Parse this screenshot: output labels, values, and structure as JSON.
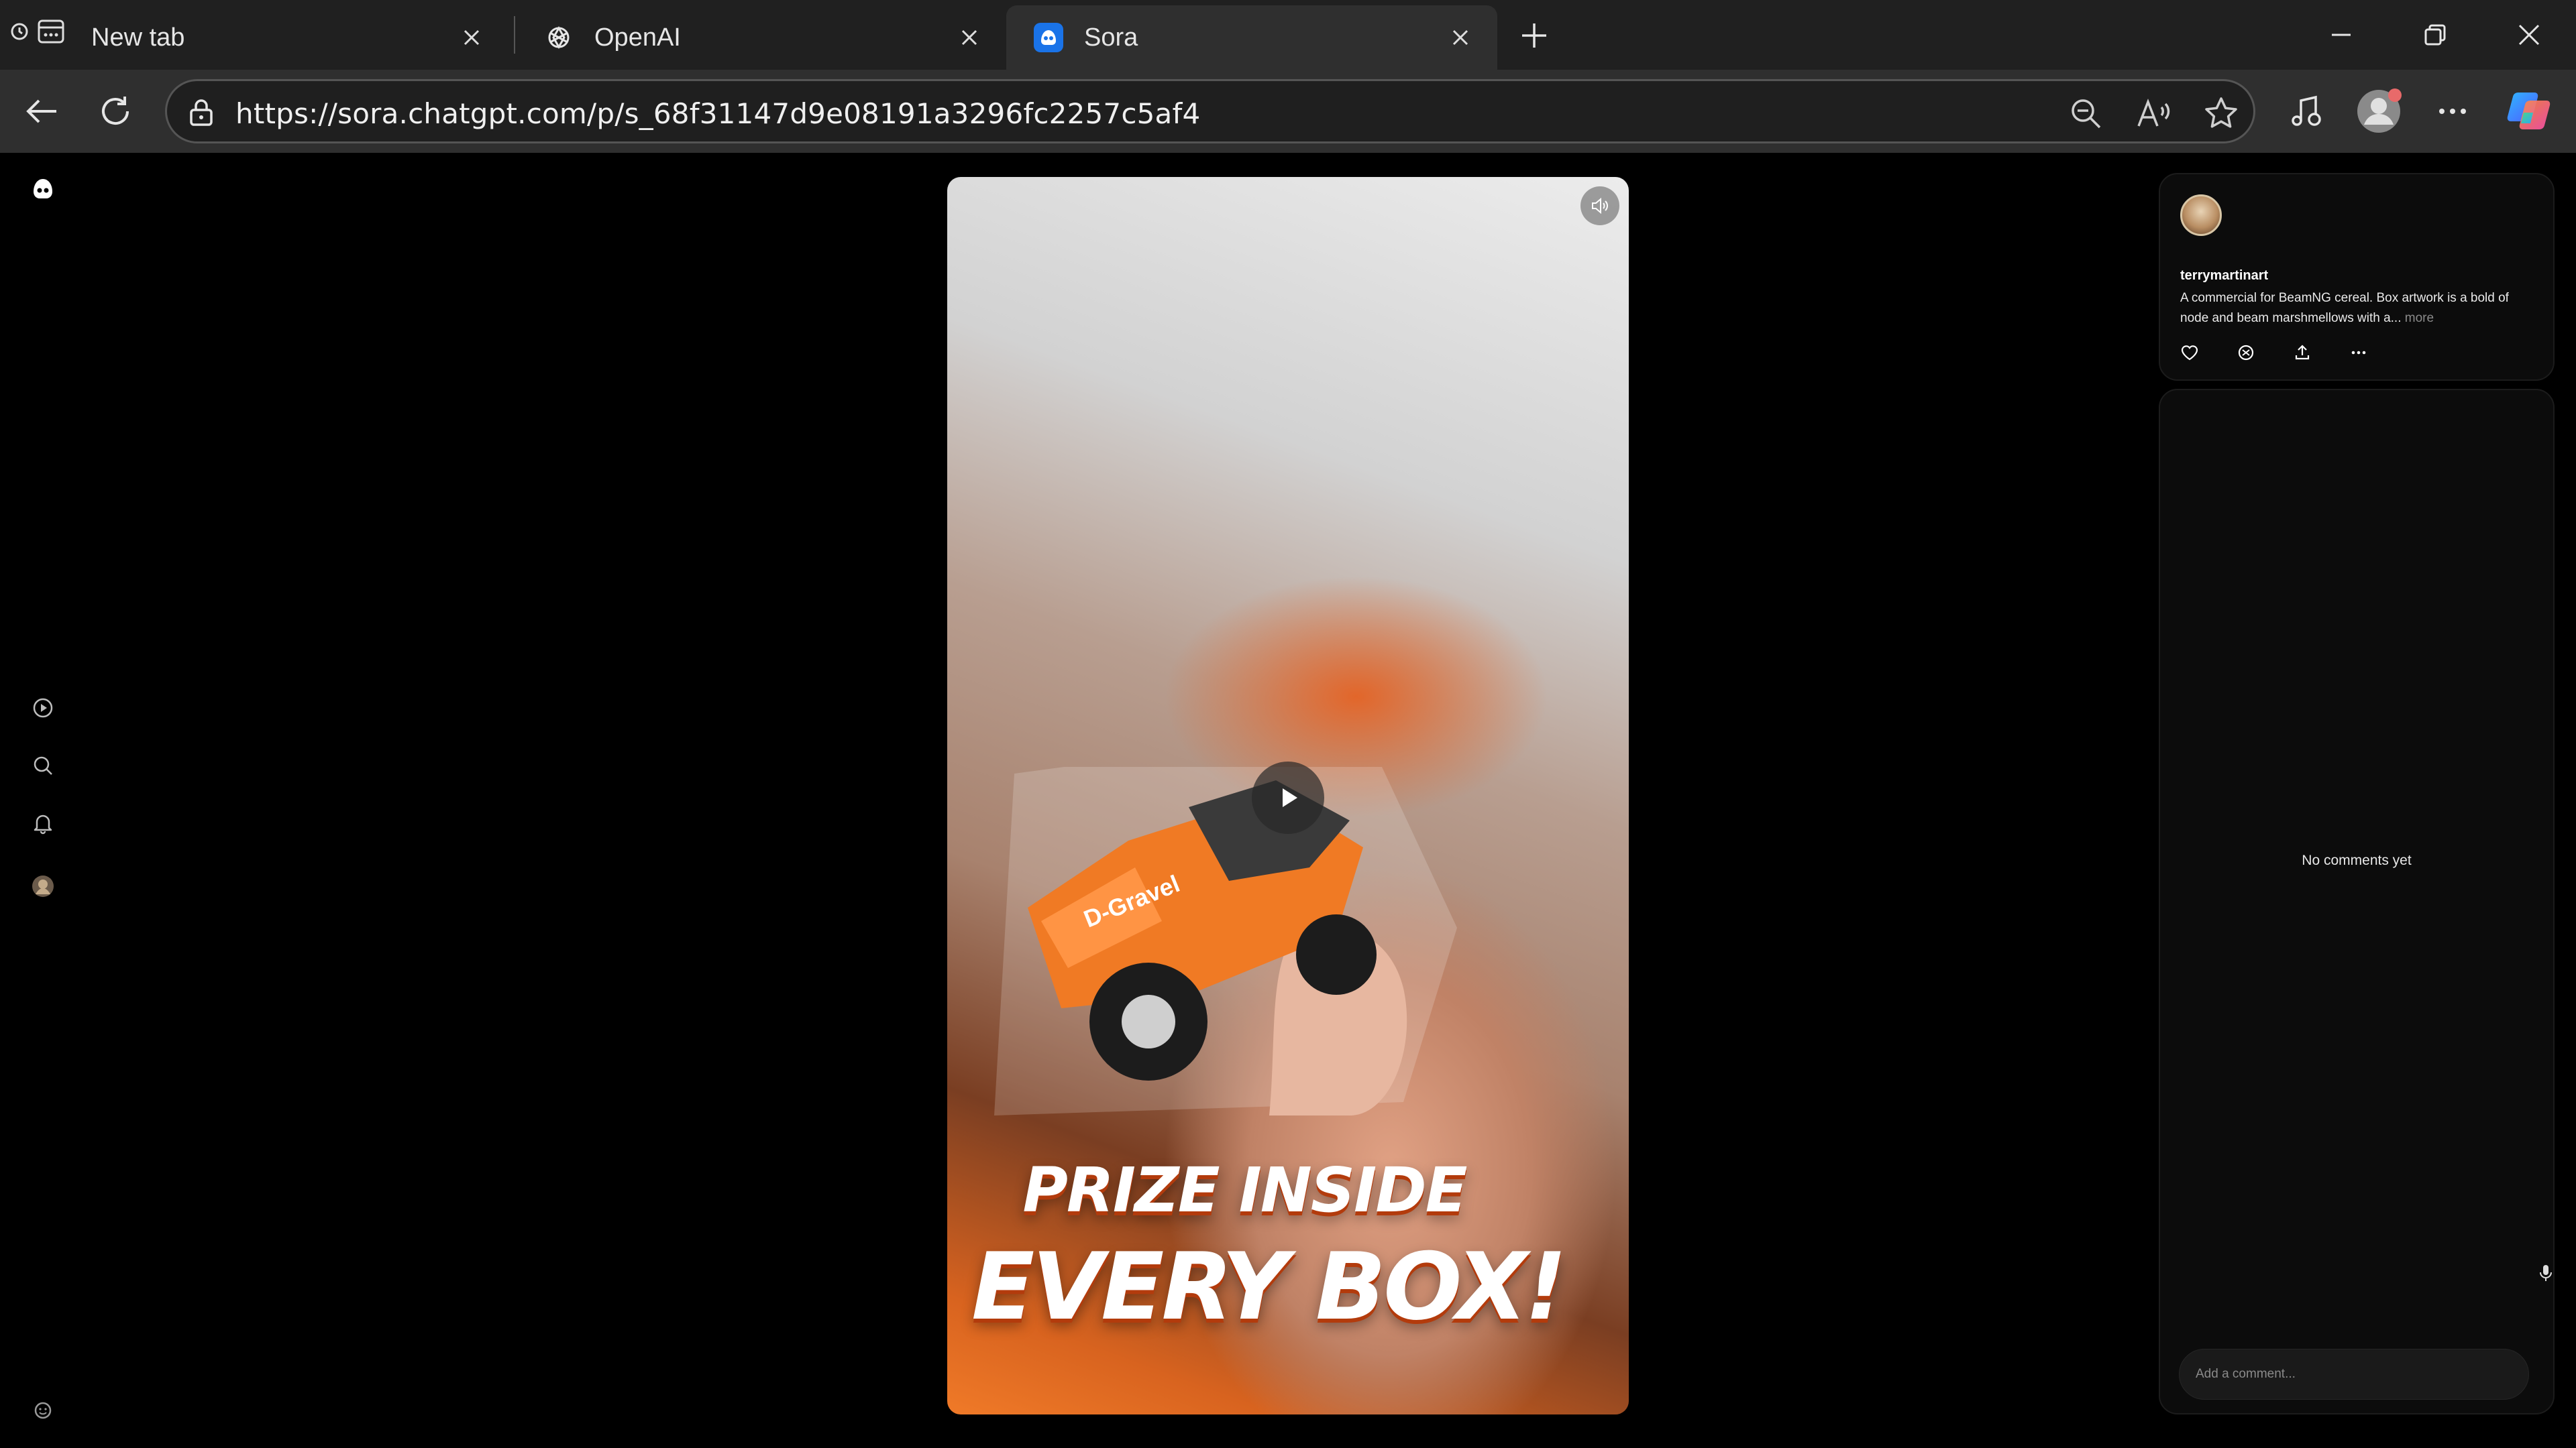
{
  "browser": {
    "tabs": [
      {
        "label": "New tab",
        "icon": "newtab-icon"
      },
      {
        "label": "OpenAI",
        "icon": "openai-logo-icon"
      },
      {
        "label": "Sora",
        "icon": "sora-logo-icon",
        "active": true
      }
    ],
    "url": "https://sora.chatgpt.com/p/s_68f31147d9e08191a3296fc2257c5af4",
    "colors": {
      "tabstrip": "#202020",
      "toolbar": "#2f2f2f",
      "accent": "#1a73e8"
    }
  },
  "video": {
    "overlay_line1": "PRIZE INSIDE",
    "overlay_line2": "EVERY BOX!",
    "car_label": "D-Gravel"
  },
  "post": {
    "username": "terrymartinart",
    "caption": "A commercial for BeamNG cereal. Box artwork is a bold of node and beam marshmellows with a...",
    "more_label": "more"
  },
  "comments": {
    "empty_text": "No comments yet",
    "input_placeholder": "Add a comment..."
  }
}
